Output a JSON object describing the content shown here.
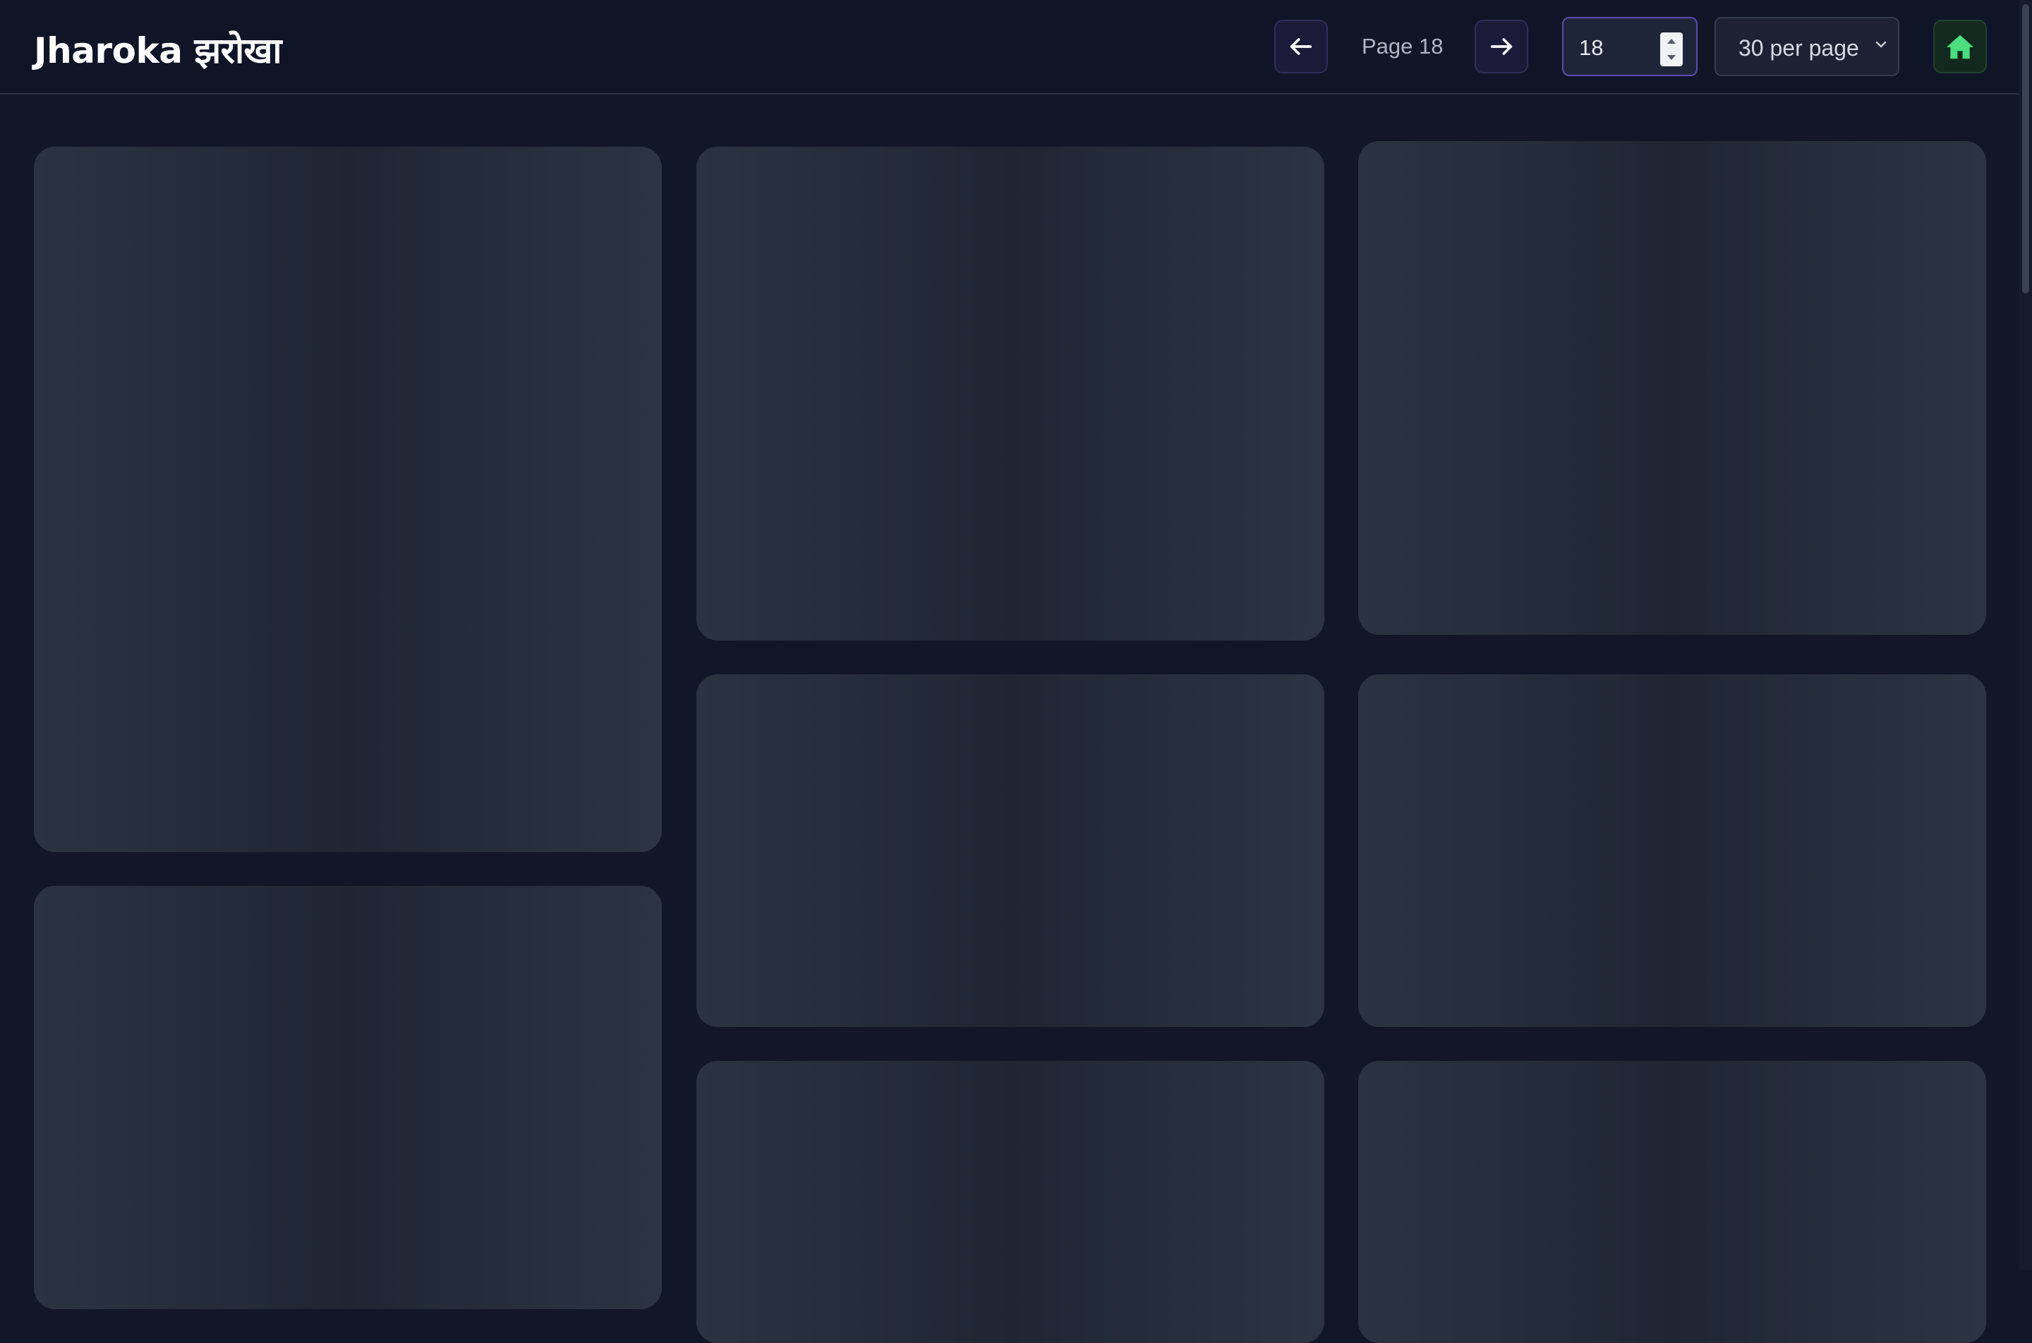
{
  "header": {
    "brand": "Jharoka झरोखा",
    "page_label": "Page 18",
    "page_input_value": "18",
    "per_page_label": "30 per page"
  },
  "icons": {
    "prev": "arrow-left-icon",
    "next": "arrow-right-icon",
    "home": "home-icon",
    "dropdown": "chevron-down-icon"
  },
  "colors": {
    "background": "#111728",
    "accent": "#5b4bb0",
    "home": "#4ade80"
  },
  "gallery": {
    "loading_placeholders": 8
  }
}
